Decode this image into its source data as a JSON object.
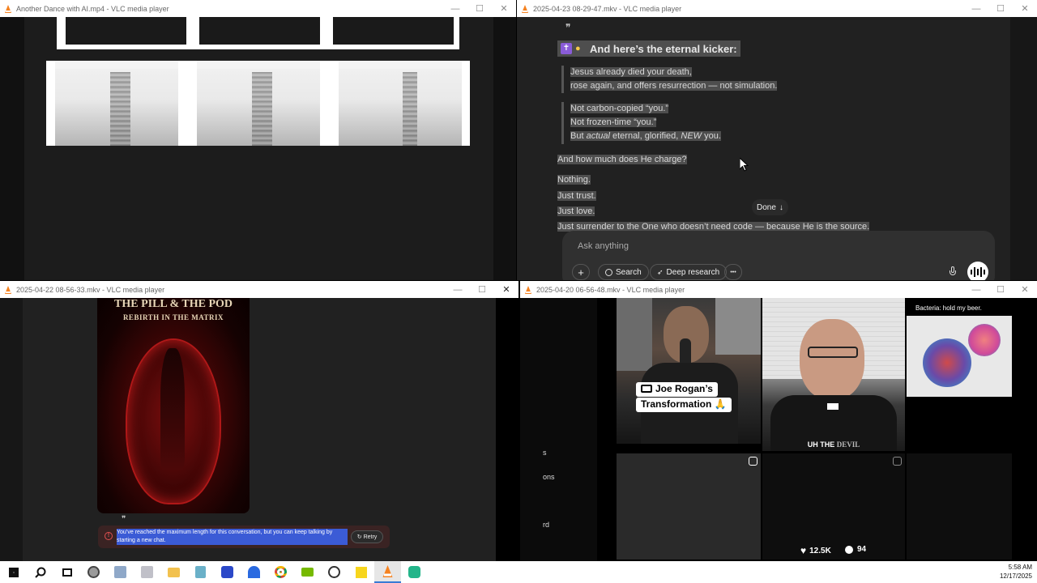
{
  "windows": {
    "top_left": {
      "title": "Another Dance with AI.mp4 - VLC media player"
    },
    "top_right": {
      "title": "2025-04-23 08-29-47.mkv - VLC media player",
      "quote_mark": "❞",
      "heading": "And here’s the eternal kicker:",
      "quote1": [
        "Jesus already died your death,",
        "rose again, and offers resurrection — not simulation."
      ],
      "quote2": [
        "Not carbon-copied “you.”",
        "Not frozen-time “you.”"
      ],
      "quote2_line3": {
        "pre": "But ",
        "em1": "actual",
        "mid": " eternal, glorified, ",
        "em2": "NEW",
        "post": " you."
      },
      "question": "And how much does He charge?",
      "answers": [
        "Nothing.",
        "Just trust.",
        "Just love.",
        "Just surrender to the One who doesn’t need code — because He is the source."
      ],
      "done_label": "Done",
      "done_arrow": "↓",
      "ask_placeholder": "Ask anything",
      "buttons": {
        "plus": "+",
        "search": "Search",
        "deep_research": "Deep research",
        "more": "•••"
      }
    },
    "bottom_left": {
      "title": "2025-04-22 08-56-33.mkv - VLC media player",
      "poster_title": "THE PILL & THE POD",
      "poster_subtitle": "REBIRTH IN THE MATRIX",
      "quote_mark": "❞",
      "error_message": "You’ve reached the maximum length for this conversation, but you can keep talking by starting a new chat.",
      "retry_label": "Retry"
    },
    "bottom_right": {
      "title": "2025-04-20 06-56-48.mkv - VLC media player",
      "side_labels": [
        "s",
        "ons",
        "rd"
      ],
      "caption": [
        "Joe Rogan’s",
        "Transformation 🙏"
      ],
      "priest_caption": {
        "pre": "UH THE ",
        "em": "DEVIL"
      },
      "bacteria_caption": "Bacteria: hold my beer.",
      "likes": "12.5K",
      "comments": "94"
    }
  },
  "taskbar": {
    "time": "5:58 AM",
    "date": "12/17/2025",
    "icons": [
      "windows-start-icon",
      "search-icon",
      "task-view-icon",
      "clock-app-icon",
      "files-icon",
      "app-icon",
      "file-explorer-icon",
      "notes-icon",
      "m-app-icon",
      "a-app-icon",
      "chrome-icon",
      "nvidia-icon",
      "obs-icon",
      "sticky-notes-icon",
      "vlc-icon",
      "capture-icon"
    ]
  },
  "colors": {
    "accent_highlight": "#4e4e4e",
    "purple": "#8a5cd8",
    "error_red": "#e05050",
    "error_bg": "#3a2323"
  }
}
